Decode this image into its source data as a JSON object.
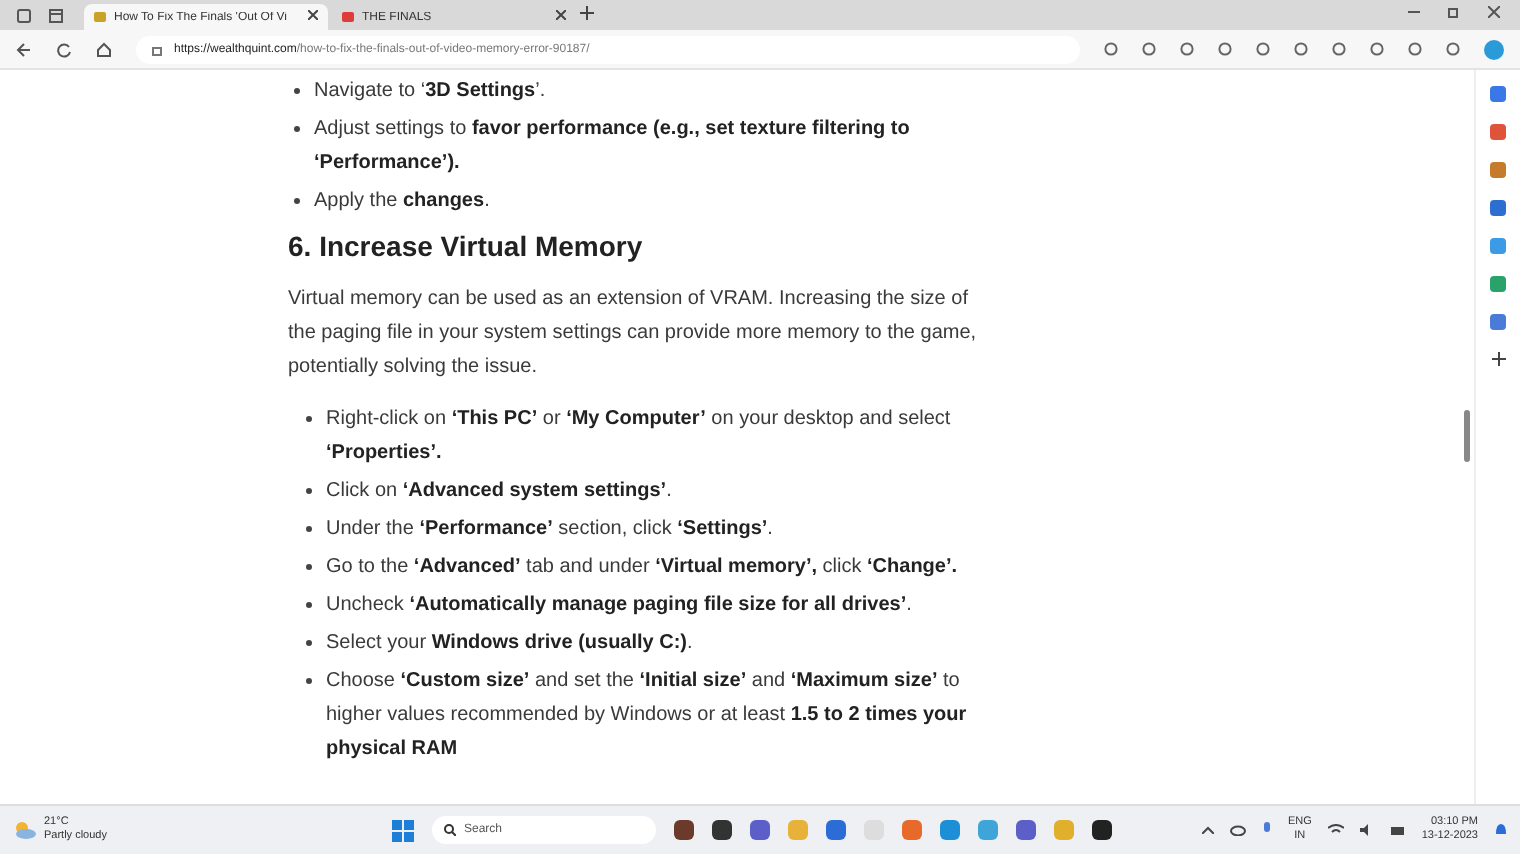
{
  "tabs": [
    {
      "label": "How To Fix The Finals 'Out Of Vi",
      "selected": true
    },
    {
      "label": "THE FINALS",
      "selected": false
    }
  ],
  "address_bar": {
    "domain": "https://wealthquint.com",
    "path": "/how-to-fix-the-finals-out-of-video-memory-error-90187/"
  },
  "article": {
    "top_items": [
      "Navigate to ‘**3D Settings**’.",
      "Adjust settings to **favor performance (e.g., set texture filtering to ‘Performance’).**",
      "Apply the **changes**."
    ],
    "heading": "6. Increase Virtual Memory",
    "paragraph": "Virtual memory can be used as an extension of VRAM. Increasing the size of the paging file in your system settings can provide more memory to the game, potentially solving the issue.",
    "steps": [
      "Right-click on **‘This PC’** or **‘My Computer’** on your desktop and select **‘Properties’.**",
      "Click on **‘Advanced system settings’**.",
      "Under the **‘Performance’** section, click **‘Settings’**.",
      "Go to the **‘Advanced’** tab and under **‘Virtual memory’,** click **‘Change’.**",
      "Uncheck **‘Automatically manage paging file size for all drives’**.",
      "Select your **Windows drive (usually C:)**.",
      "Choose **‘Custom size’** and set the **‘Initial size’** and **‘Maximum size’** to higher values recommended by Windows or at least **1.5 to 2 times your physical RAM**"
    ]
  },
  "taskbar": {
    "temperature": "21°C",
    "weather": "Partly cloudy",
    "search_placeholder": "Search",
    "language": "ENG",
    "region": "IN",
    "time": "03:10 PM",
    "date": "13-12-2023"
  }
}
